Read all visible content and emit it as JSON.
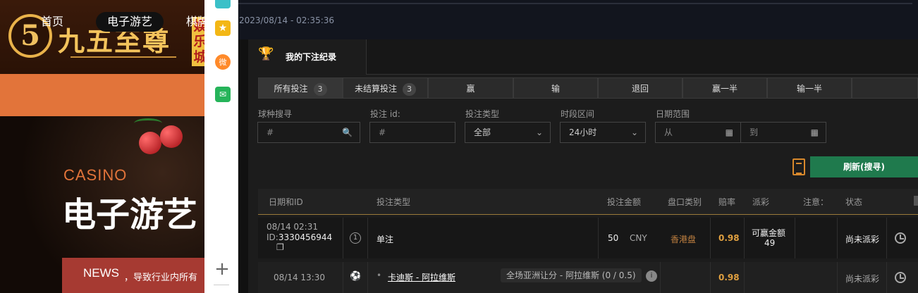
{
  "site": {
    "logo_mark": "5",
    "logo_text": "九五至尊",
    "logo_tag": "娱乐城",
    "nav": {
      "home": "首页",
      "egames": "电子游艺",
      "chess": "棋牌"
    },
    "hero": {
      "casino": "CASINO",
      "title": "电子游艺"
    },
    "news": {
      "label": "NEWS",
      "text": "，导致行业内所有"
    }
  },
  "toolbar": {
    "star": "★",
    "weibo": "微",
    "mail": "✉",
    "plus": "+"
  },
  "app": {
    "timestamp": "2023/08/14 - 02:35:36",
    "title": "我的下注纪录",
    "tabs": [
      {
        "label": "所有投注",
        "count": "3"
      },
      {
        "label": "未结算投注",
        "count": "3"
      },
      {
        "label": "赢"
      },
      {
        "label": "输"
      },
      {
        "label": "退回"
      },
      {
        "label": "赢一半"
      },
      {
        "label": "输一半"
      }
    ],
    "filters": {
      "sport_label": "球种搜寻",
      "sport_placeholder": "#",
      "betid_label": "投注 id:",
      "betid_placeholder": "#",
      "bettype_label": "投注类型",
      "bettype_value": "全部",
      "period_label": "时段区间",
      "period_value": "24小时",
      "date_label": "日期范围",
      "date_from": "从",
      "date_to": "到"
    },
    "refresh_label": "刷新(搜寻)",
    "columns": [
      "日期和ID",
      "投注类型",
      "投注金额",
      "盘口类别",
      "赔率",
      "派彩",
      "注意：",
      "状态"
    ],
    "rows": [
      {
        "date": "08/14 02:31",
        "id_prefix": "ID:",
        "id": "3330456944",
        "count": "1",
        "type": "单注",
        "amount": "50",
        "currency": "CNY",
        "market": "香港盘",
        "odds": "0.98",
        "payout_label": "可赢金额",
        "payout_value": "49",
        "status": "尚未派彩"
      },
      {
        "date": "08/14 13:30",
        "match": "卡迪斯 - 阿拉维斯",
        "selection": "全场亚洲让分 - 阿拉维斯 (0 / 0.5)",
        "odds": "0.98",
        "status": "尚未派彩"
      }
    ]
  }
}
